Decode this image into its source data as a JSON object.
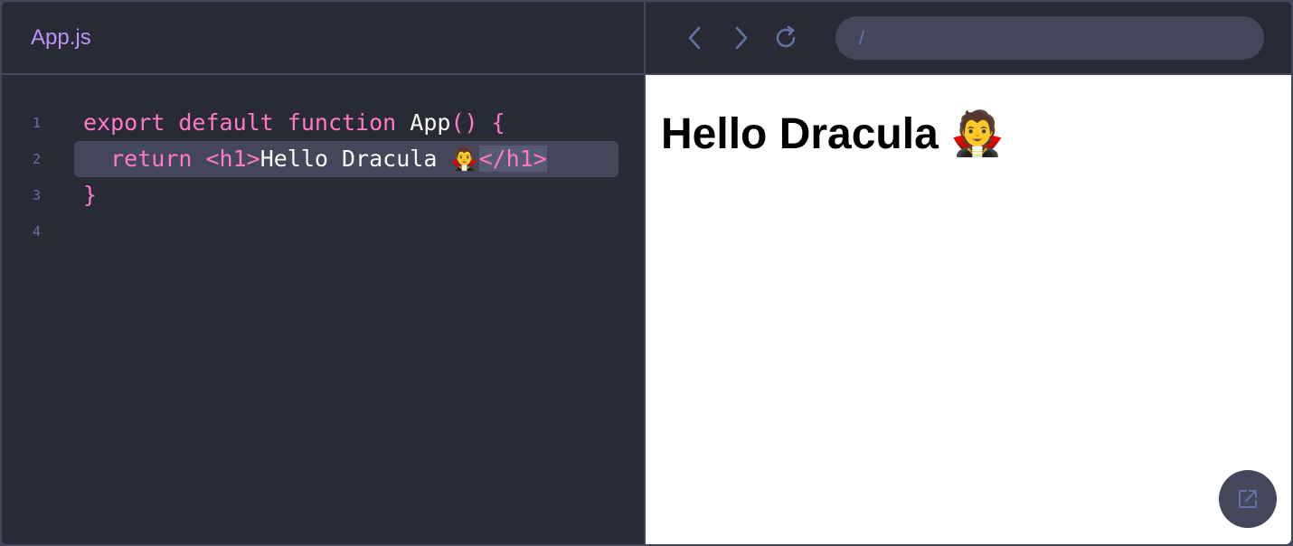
{
  "editor": {
    "file_tab": "App.js",
    "lines": [
      {
        "number": "1"
      },
      {
        "number": "2"
      },
      {
        "number": "3"
      },
      {
        "number": "4"
      }
    ],
    "tokens": {
      "l1_export": "export",
      "l1_default": "default",
      "l1_function": "function",
      "l1_name": "App",
      "l1_parens": "()",
      "l1_brace": "{",
      "l2_indent": "  ",
      "l2_return": "return",
      "l2_open_tag": "<h1>",
      "l2_text": "Hello Dracula 🧛",
      "l2_close_tag": "</h1>",
      "l3_brace": "}"
    }
  },
  "preview": {
    "url": "/",
    "heading": "Hello Dracula 🧛"
  },
  "colors": {
    "background": "#282a36",
    "current_line": "#44475a",
    "comment": "#6272a4",
    "pink": "#ff79c6",
    "purple": "#bd93f9",
    "foreground": "#f8f8f2"
  }
}
